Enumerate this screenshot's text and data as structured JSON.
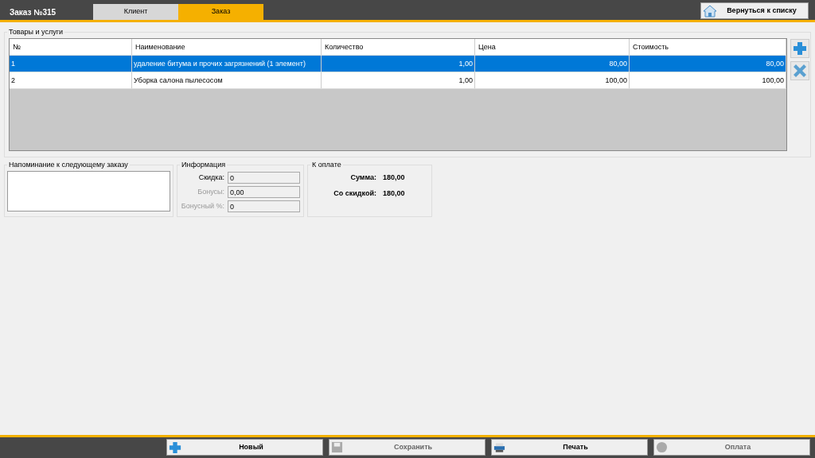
{
  "header": {
    "title": "Заказ №315",
    "tabs": [
      {
        "label": "Клиент",
        "selected": false
      },
      {
        "label": "Заказ",
        "selected": true
      }
    ],
    "back_button": "Вернуться к списку"
  },
  "goods": {
    "title": "Товары и услуги",
    "columns": [
      "№",
      "Наименование",
      "Количество",
      "Цена",
      "Стоимость"
    ],
    "rows": [
      {
        "cells": [
          "1",
          "удаление битума и прочих загрязнений (1 элемент)",
          "1,00",
          "80,00",
          "80,00"
        ],
        "selected": true
      },
      {
        "cells": [
          "2",
          "Уборка салона пылесосом",
          "1,00",
          "100,00",
          "100,00"
        ],
        "selected": false
      }
    ]
  },
  "reminder": {
    "title": "Напоминание к следующему заказу"
  },
  "info": {
    "title": "Информация",
    "fields": [
      {
        "label": "Скидка:",
        "value": "0",
        "disabled": false
      },
      {
        "label": "Бонусы:",
        "value": "0,00",
        "disabled": true
      },
      {
        "label": "Бонусный %:",
        "value": "0",
        "disabled": true
      }
    ]
  },
  "payment": {
    "title": "К оплате",
    "lines": [
      {
        "label": "Сумма:",
        "value": "180,00"
      },
      {
        "label": "Со скидкой:",
        "value": "180,00"
      }
    ]
  },
  "footer": [
    {
      "kind": "new",
      "label": "Новый",
      "disabled": false
    },
    {
      "kind": "save",
      "label": "Сохранить",
      "disabled": true
    },
    {
      "kind": "print",
      "label": "Печать",
      "disabled": false
    },
    {
      "kind": "pay",
      "label": "Оплата",
      "disabled": true
    }
  ]
}
